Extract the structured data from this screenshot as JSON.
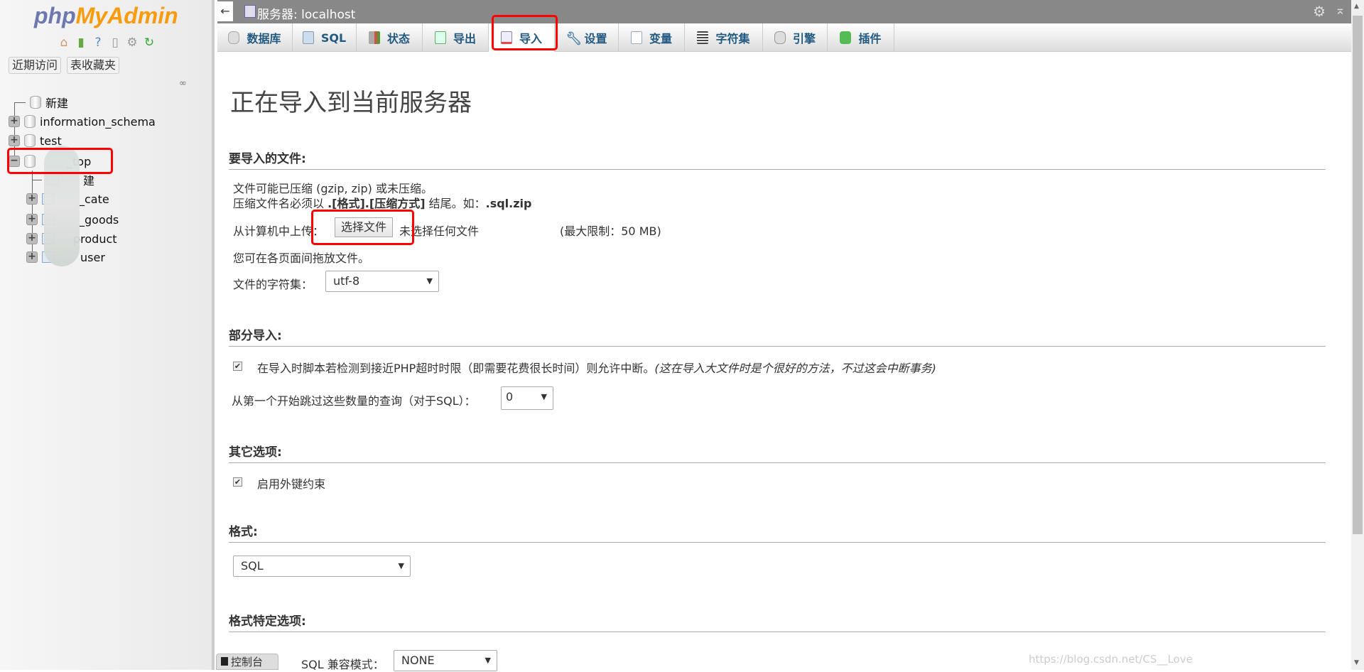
{
  "sidebar": {
    "logo_php": "php",
    "logo_myadmin": "MyAdmin",
    "recent_label": "近期访问",
    "favorites_label": "表收藏夹",
    "tree": [
      {
        "label": "新建",
        "type": "new"
      },
      {
        "label": "information_schema",
        "type": "db"
      },
      {
        "label": "test",
        "type": "db"
      },
      {
        "label": "_top",
        "type": "db-open"
      },
      {
        "label": "建",
        "type": "new-table"
      },
      {
        "label": "_cate",
        "type": "table"
      },
      {
        "label": "_goods",
        "type": "table"
      },
      {
        "label": "product",
        "type": "table"
      },
      {
        "label": "user",
        "type": "table"
      }
    ]
  },
  "topbar": {
    "back": "←",
    "title": "服务器: localhost"
  },
  "tabs": [
    {
      "label": "数据库",
      "icon": "database-icon"
    },
    {
      "label": "SQL",
      "icon": "sql-icon"
    },
    {
      "label": "状态",
      "icon": "status-icon"
    },
    {
      "label": "导出",
      "icon": "export-icon"
    },
    {
      "label": "导入",
      "icon": "import-icon",
      "active": true
    },
    {
      "label": "设置",
      "icon": "wrench-icon"
    },
    {
      "label": "变量",
      "icon": "variables-icon"
    },
    {
      "label": "字符集",
      "icon": "charset-icon"
    },
    {
      "label": "引擎",
      "icon": "engine-icon"
    },
    {
      "label": "插件",
      "icon": "plugin-icon"
    }
  ],
  "main": {
    "title": "正在导入到当前服务器",
    "file_section": {
      "heading": "要导入的文件:",
      "line1": "文件可能已压缩 (gzip, zip) 或未压缩。",
      "line2_prefix": "压缩文件名必须以 ",
      "line2_bold": ".[格式].[压缩方式]",
      "line2_mid": " 结尾。如：",
      "line2_example": ".sql.zip",
      "upload_label": "从计算机中上传：",
      "choose_button": "选择文件",
      "no_file": "未选择任何文件",
      "max_limit": "(最大限制：50 MB)",
      "drag_hint": "您可在各页面间拖放文件。",
      "charset_label": "文件的字符集：",
      "charset_value": "utf-8"
    },
    "partial_section": {
      "heading": "部分导入:",
      "interrupt_label": "在导入时脚本若检测到接近PHP超时时限（即需要花费很长时间）则允许中断。",
      "interrupt_note": "(这在导入大文件时是个很好的方法，不过这会中断事务)",
      "interrupt_checked": true,
      "skip_label": "从第一个开始跳过这些数量的查询（对于SQL）：",
      "skip_value": "0"
    },
    "other_section": {
      "heading": "其它选项:",
      "fk_label": "启用外键约束",
      "fk_checked": true
    },
    "format_section": {
      "heading": "格式:",
      "format_value": "SQL"
    },
    "format_options_section": {
      "heading": "格式特定选项:",
      "compat_label": "SQL 兼容模式：",
      "compat_value": "NONE"
    }
  },
  "console": {
    "label": "控制台"
  },
  "watermark": "https://blog.csdn.net/CS__Love",
  "colors": {
    "highlight": "#ff0000",
    "topbar": "#888888",
    "tab_text": "#235a81"
  }
}
